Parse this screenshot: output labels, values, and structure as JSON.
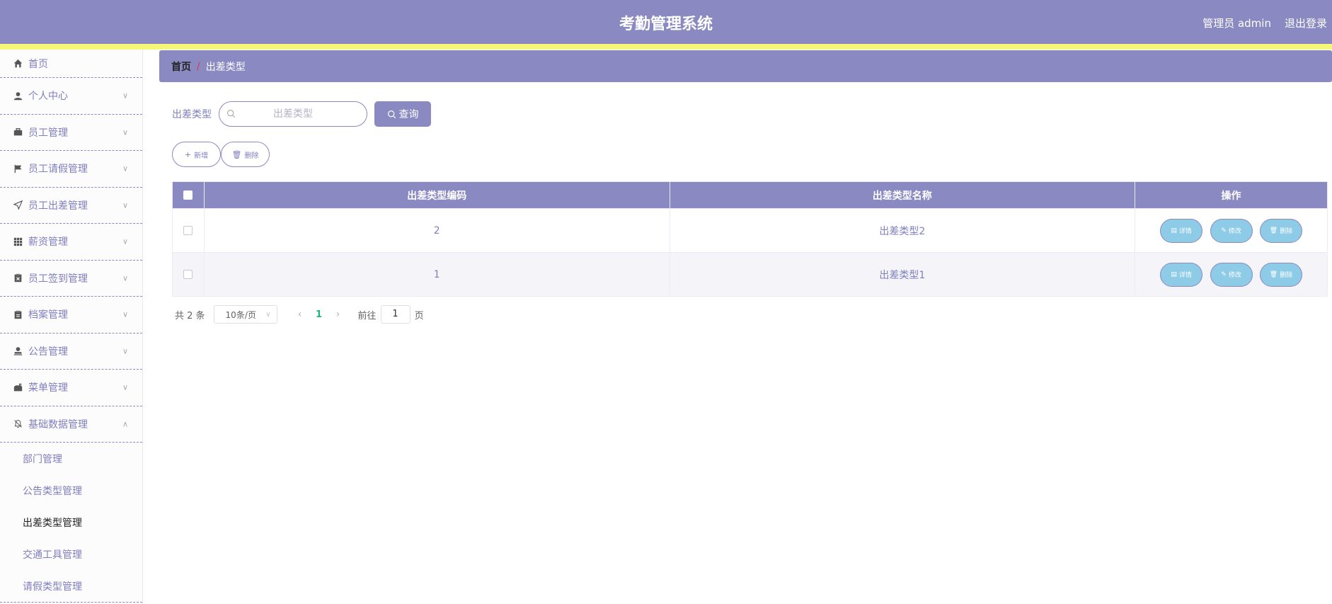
{
  "header": {
    "title": "考勤管理系统",
    "user": "管理员 admin",
    "logout": "退出登录"
  },
  "sidebar": {
    "items": [
      {
        "label": "首页",
        "icon": "home-icon"
      },
      {
        "label": "个人中心",
        "icon": "user-icon"
      },
      {
        "label": "员工管理",
        "icon": "briefcase-icon"
      },
      {
        "label": "员工请假管理",
        "icon": "flag-icon"
      },
      {
        "label": "员工出差管理",
        "icon": "send-icon"
      },
      {
        "label": "薪资管理",
        "icon": "grid-icon"
      },
      {
        "label": "员工签到管理",
        "icon": "clipboard-x-icon"
      },
      {
        "label": "档案管理",
        "icon": "clipboard-icon"
      },
      {
        "label": "公告管理",
        "icon": "stamp-icon"
      },
      {
        "label": "菜单管理",
        "icon": "mailbox-icon"
      },
      {
        "label": "基础数据管理",
        "icon": "bell-off-icon"
      }
    ],
    "subitems": [
      "部门管理",
      "公告类型管理",
      "出差类型管理",
      "交通工具管理",
      "请假类型管理"
    ]
  },
  "breadcrumb": {
    "home": "首页",
    "sep": "/",
    "current": "出差类型"
  },
  "search": {
    "label": "出差类型",
    "placeholder": "出差类型",
    "button": "查询"
  },
  "actions": {
    "add": "新增",
    "delete": "删除"
  },
  "table": {
    "columns": [
      "出差类型编码",
      "出差类型名称",
      "操作"
    ],
    "rows": [
      {
        "code": "2",
        "name": "出差类型2"
      },
      {
        "code": "1",
        "name": "出差类型1"
      }
    ],
    "row_actions": {
      "detail": "详情",
      "edit": "修改",
      "delete": "删除"
    }
  },
  "pagination": {
    "total": "共 2 条",
    "page_size": "10条/页",
    "current": "1",
    "goto_prefix": "前往",
    "goto_value": "1",
    "goto_suffix": "页"
  },
  "colors": {
    "primary": "#8a89c2",
    "stripe": "#f6f77a",
    "op_button": "#8ecbe7",
    "active_page": "#22b47b"
  }
}
